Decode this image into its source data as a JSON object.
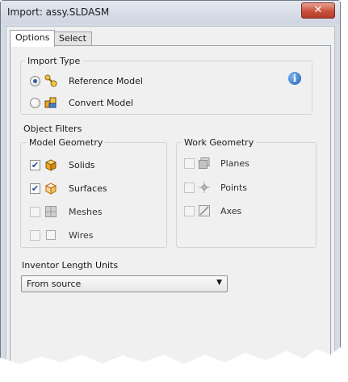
{
  "window": {
    "title": "Import:  assy.SLDASM",
    "close_glyph": "✕"
  },
  "tabs": [
    {
      "label": "Options"
    },
    {
      "label": "Select"
    }
  ],
  "import_type": {
    "label": "Import Type",
    "options": [
      {
        "label": "Reference Model",
        "checked": true,
        "icon": "reference-model-icon"
      },
      {
        "label": "Convert Model",
        "checked": false,
        "icon": "convert-model-icon"
      }
    ],
    "info_glyph": "i"
  },
  "object_filters": {
    "label": "Object Filters",
    "model_geometry": {
      "label": "Model Geometry",
      "items": [
        {
          "label": "Solids",
          "checked": true,
          "enabled": true,
          "icon": "solid-cube-icon"
        },
        {
          "label": "Surfaces",
          "checked": true,
          "enabled": true,
          "icon": "surface-cube-icon"
        },
        {
          "label": "Meshes",
          "checked": false,
          "enabled": false,
          "icon": "mesh-grid-icon"
        },
        {
          "label": "Wires",
          "checked": false,
          "enabled": false,
          "icon": "wire-square-icon"
        }
      ]
    },
    "work_geometry": {
      "label": "Work Geometry",
      "items": [
        {
          "label": "Planes",
          "checked": false,
          "enabled": false,
          "icon": "work-plane-icon"
        },
        {
          "label": "Points",
          "checked": false,
          "enabled": false,
          "icon": "work-point-icon"
        },
        {
          "label": "Axes",
          "checked": false,
          "enabled": false,
          "icon": "work-axis-icon"
        }
      ]
    }
  },
  "units": {
    "label": "Inventor Length Units",
    "value": "From source"
  },
  "check_glyph": "✔",
  "colors": {
    "accent": "#2b5aa8",
    "close_button": "#c9503a",
    "icon_orange": "#f2a320"
  }
}
